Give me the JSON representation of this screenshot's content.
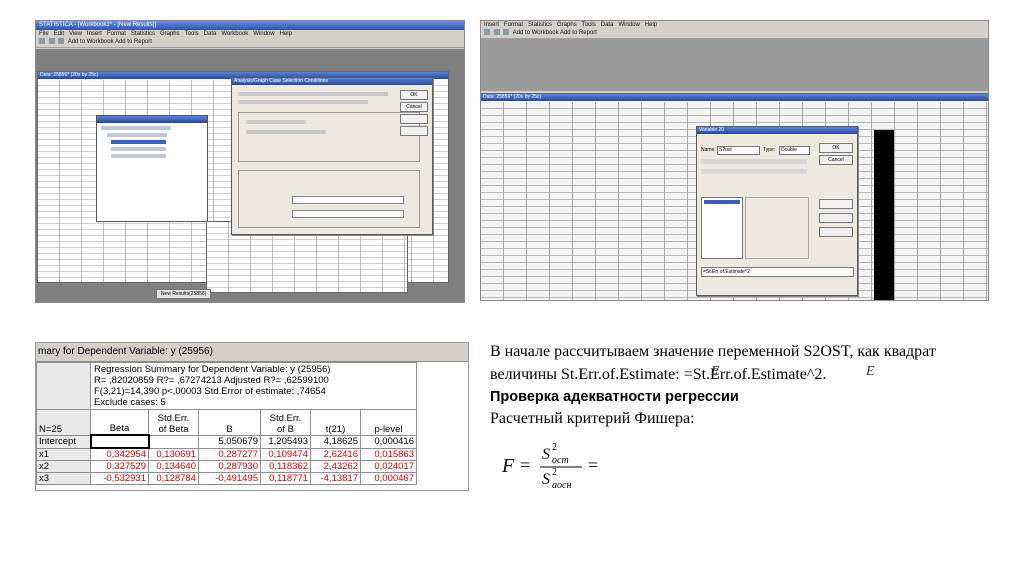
{
  "left_window": {
    "title": "STATISTICA - [Workbook1* - [New Results]]",
    "menus": [
      "File",
      "Edit",
      "View",
      "Insert",
      "Format",
      "Statistics",
      "Graphs",
      "Tools",
      "Data",
      "Workbook",
      "Window",
      "Help"
    ],
    "toolbar_text": "Add to Workbook  Add to Report",
    "spreadsheet_title": "Data: 25856* (20v by 25c)",
    "dialog_title": "Analysis/Graph Case Selection Conditions",
    "ok_label": "OK",
    "cancel_label": "Cancel",
    "tab_label": "New Results(25856)"
  },
  "right_window": {
    "menus": [
      "Insert",
      "Format",
      "Statistics",
      "Graphs",
      "Tools",
      "Data",
      "Window",
      "Help"
    ],
    "toolbar_text": "Add to Workbook  Add to Report",
    "spreadsheet_title": "Data: 25856* (20v by 25c)",
    "dialog_title": "Variable 20",
    "name_label": "Name:",
    "name_value": "S2ost",
    "type_label": "Type:",
    "type_value": "Double",
    "ok_label": "OK",
    "cancel_label": "Cancel",
    "long_name_value": "=St.Err.of.Estimate^2"
  },
  "results": {
    "title": "mary for Dependent Variable: y (25956)",
    "summary_lines": [
      "Regression Summary for Dependent Variable: y (25956)",
      "R= ,82020859 R?= ,67274213 Adjusted R?= ,62599100",
      "F(3,21)=14,390 p<,00003 Std.Error of estimate: ,74654",
      "Exclude cases: 5"
    ],
    "n_label": "N=25",
    "columns": [
      "Beta",
      "Std.Err.\nof Beta",
      "B",
      "Std.Err.\nof B",
      "t(21)",
      "p-level"
    ],
    "rows": [
      {
        "label": "Intercept",
        "cells": [
          "",
          "",
          "5,050679",
          "1,205493",
          "4,18625",
          "0,000416"
        ]
      },
      {
        "label": "x1",
        "cells": [
          "0,342954",
          "0,130691",
          "0,287277",
          "0,109474",
          "2,62416",
          "0,015863"
        ]
      },
      {
        "label": "x2",
        "cells": [
          "0,327529",
          "0,134640",
          "0,287930",
          "0,118362",
          "2,43262",
          "0,024017"
        ]
      },
      {
        "label": "x3",
        "cells": [
          "-0,532931",
          "0,128784",
          "-0,491495",
          "0,118771",
          "-4,13817",
          "0,000467"
        ]
      }
    ]
  },
  "text": {
    "p1": "В начале рассчитываем значение переменной S2OST, как квадрат величины St.Err.of.Estimate: =St.Err.of.Estimate^2.",
    "p2": "Проверка адекватности регрессии",
    "p3": "Расчетный критерий Фишера:",
    "formula_F": "F",
    "formula_num": "S",
    "formula_num_sup": "2",
    "formula_num_sub": "ост",
    "formula_den": "S",
    "formula_den_sup": "2",
    "formula_den_sub": "аосн",
    "formula_eq": "="
  },
  "colors": {
    "red_value": "#e00000",
    "title_blue": "#2d55b0"
  }
}
